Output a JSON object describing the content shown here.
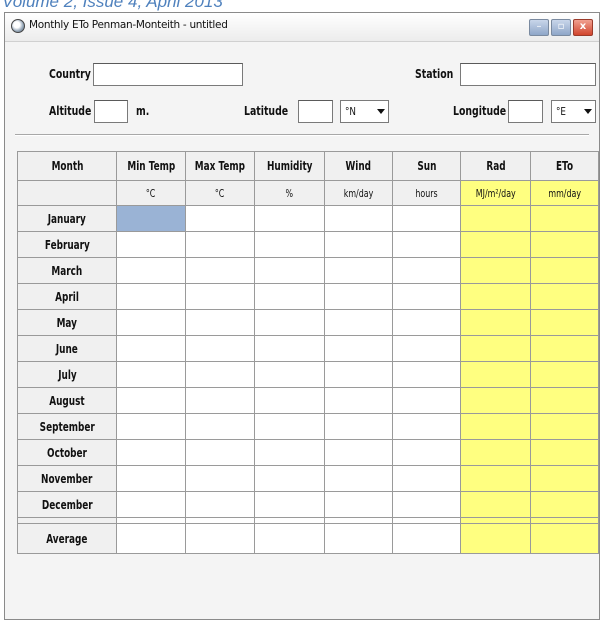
{
  "doc_header": "Volume 2, Issue 4, April 2013",
  "window": {
    "title": "Monthly ETo Penman-Monteith - untitled",
    "controls": {
      "minimize": "–",
      "maximize": "▫",
      "close": "x"
    }
  },
  "form": {
    "country_label": "Country",
    "country_value": "",
    "station_label": "Station",
    "station_value": "",
    "altitude_label": "Altitude",
    "altitude_value": "",
    "altitude_unit": "m.",
    "latitude_label": "Latitude",
    "latitude_value": "",
    "latitude_hemisphere": "°N",
    "longitude_label": "Longitude",
    "longitude_value": "",
    "longitude_hemisphere": "°E"
  },
  "table": {
    "columns": [
      {
        "header": "Month",
        "unit": ""
      },
      {
        "header": "Min Temp",
        "unit": "°C"
      },
      {
        "header": "Max Temp",
        "unit": "°C"
      },
      {
        "header": "Humidity",
        "unit": "%"
      },
      {
        "header": "Wind",
        "unit": "km/day"
      },
      {
        "header": "Sun",
        "unit": "hours"
      },
      {
        "header": "Rad",
        "unit": "MJ/m²/day"
      },
      {
        "header": "ETo",
        "unit": "mm/day"
      }
    ],
    "months": [
      "January",
      "February",
      "March",
      "April",
      "May",
      "June",
      "July",
      "August",
      "September",
      "October",
      "November",
      "December"
    ],
    "average_label": "Average",
    "highlight_color": "#ffff80",
    "selected_cell_color": "#9ab3d5"
  }
}
